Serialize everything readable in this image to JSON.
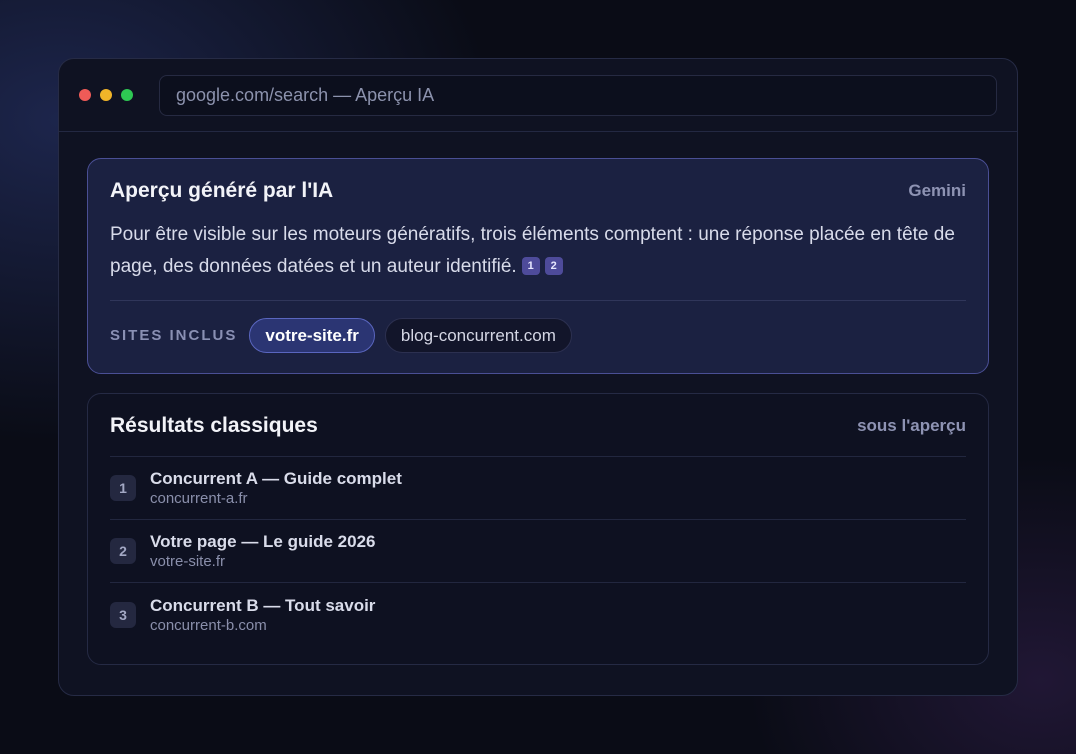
{
  "window": {
    "url": "google.com/search — Aperçu IA"
  },
  "ai_overview": {
    "title": "Aperçu généré par l'IA",
    "provider": "Gemini",
    "text": "Pour être visible sur les moteurs génératifs, trois éléments comptent : une réponse placée en tête de page, des données datées et un auteur identifié.",
    "citations": [
      "1",
      "2"
    ],
    "sites_label": "SITES INCLUS",
    "sites": [
      {
        "label": "votre-site.fr",
        "active": true
      },
      {
        "label": "blog-concurrent.com",
        "active": false
      }
    ]
  },
  "classic_results": {
    "title": "Résultats classiques",
    "tag": "sous l'aperçu",
    "items": [
      {
        "rank": "1",
        "title": "Concurrent A — Guide complet",
        "url": "concurrent-a.fr"
      },
      {
        "rank": "2",
        "title": "Votre page — Le guide 2026",
        "url": "votre-site.fr"
      },
      {
        "rank": "3",
        "title": "Concurrent B — Tout savoir",
        "url": "concurrent-b.com"
      }
    ]
  },
  "colors": {
    "close": "#ef5b57",
    "minimize": "#f0b429",
    "maximize": "#2ec753",
    "accent": "#4e4b9a"
  }
}
